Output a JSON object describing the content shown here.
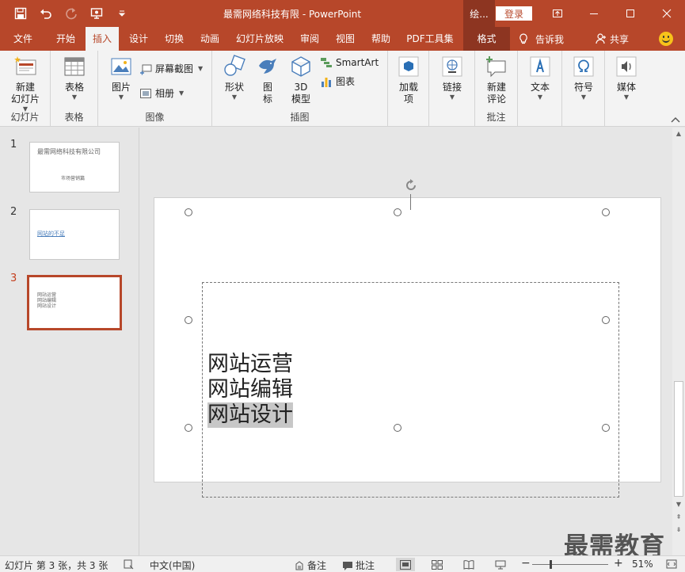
{
  "window": {
    "title": "最需网络科技有限 - PowerPoint",
    "context_tab_header": "绘...",
    "login_label": "登录"
  },
  "tabs": [
    {
      "label": "文件"
    },
    {
      "label": "开始"
    },
    {
      "label": "插入"
    },
    {
      "label": "设计"
    },
    {
      "label": "切换"
    },
    {
      "label": "动画"
    },
    {
      "label": "幻灯片放映"
    },
    {
      "label": "审阅"
    },
    {
      "label": "视图"
    },
    {
      "label": "帮助"
    },
    {
      "label": "PDF工具集"
    },
    {
      "label": "格式"
    }
  ],
  "tell_me": "告诉我",
  "share": "共享",
  "ribbon": {
    "slides": {
      "label": "幻灯片",
      "new_slide": "新建\n幻灯片"
    },
    "tables": {
      "label": "表格",
      "table": "表格"
    },
    "images": {
      "label": "图像",
      "picture": "图片",
      "screenshot": "屏幕截图",
      "album": "相册"
    },
    "illustrations": {
      "label": "插图",
      "shapes": "形状",
      "icons": "图\n标",
      "model3d": "3D\n模型",
      "smartart": "SmartArt",
      "chart": "图表"
    },
    "addins": {
      "addin": "加载\n项"
    },
    "links": {
      "link": "链接"
    },
    "comments": {
      "label": "批注",
      "new_comment": "新建\n评论"
    },
    "text": {
      "text": "文本"
    },
    "symbols": {
      "symbol": "符号"
    },
    "media": {
      "media": "媒体"
    }
  },
  "thumbnails": [
    {
      "num": "1",
      "title": "最需网络科技有限公司",
      "subtitle": "市场营销篇"
    },
    {
      "num": "2",
      "link": "网站的不足"
    },
    {
      "num": "3",
      "lines": [
        "网站运营",
        "网站编辑",
        "网站设计"
      ]
    }
  ],
  "slide": {
    "lines": [
      "网站运营",
      "网站编辑",
      "网站设计"
    ]
  },
  "watermark": "最需教育",
  "status": {
    "slide_info": "幻灯片 第 3 张，共 3 张",
    "language": "中文(中国)",
    "notes": "备注",
    "comments": "批注",
    "zoom": "51%"
  },
  "colors": {
    "accent": "#b7472a",
    "accent_dark": "#8d3521"
  }
}
